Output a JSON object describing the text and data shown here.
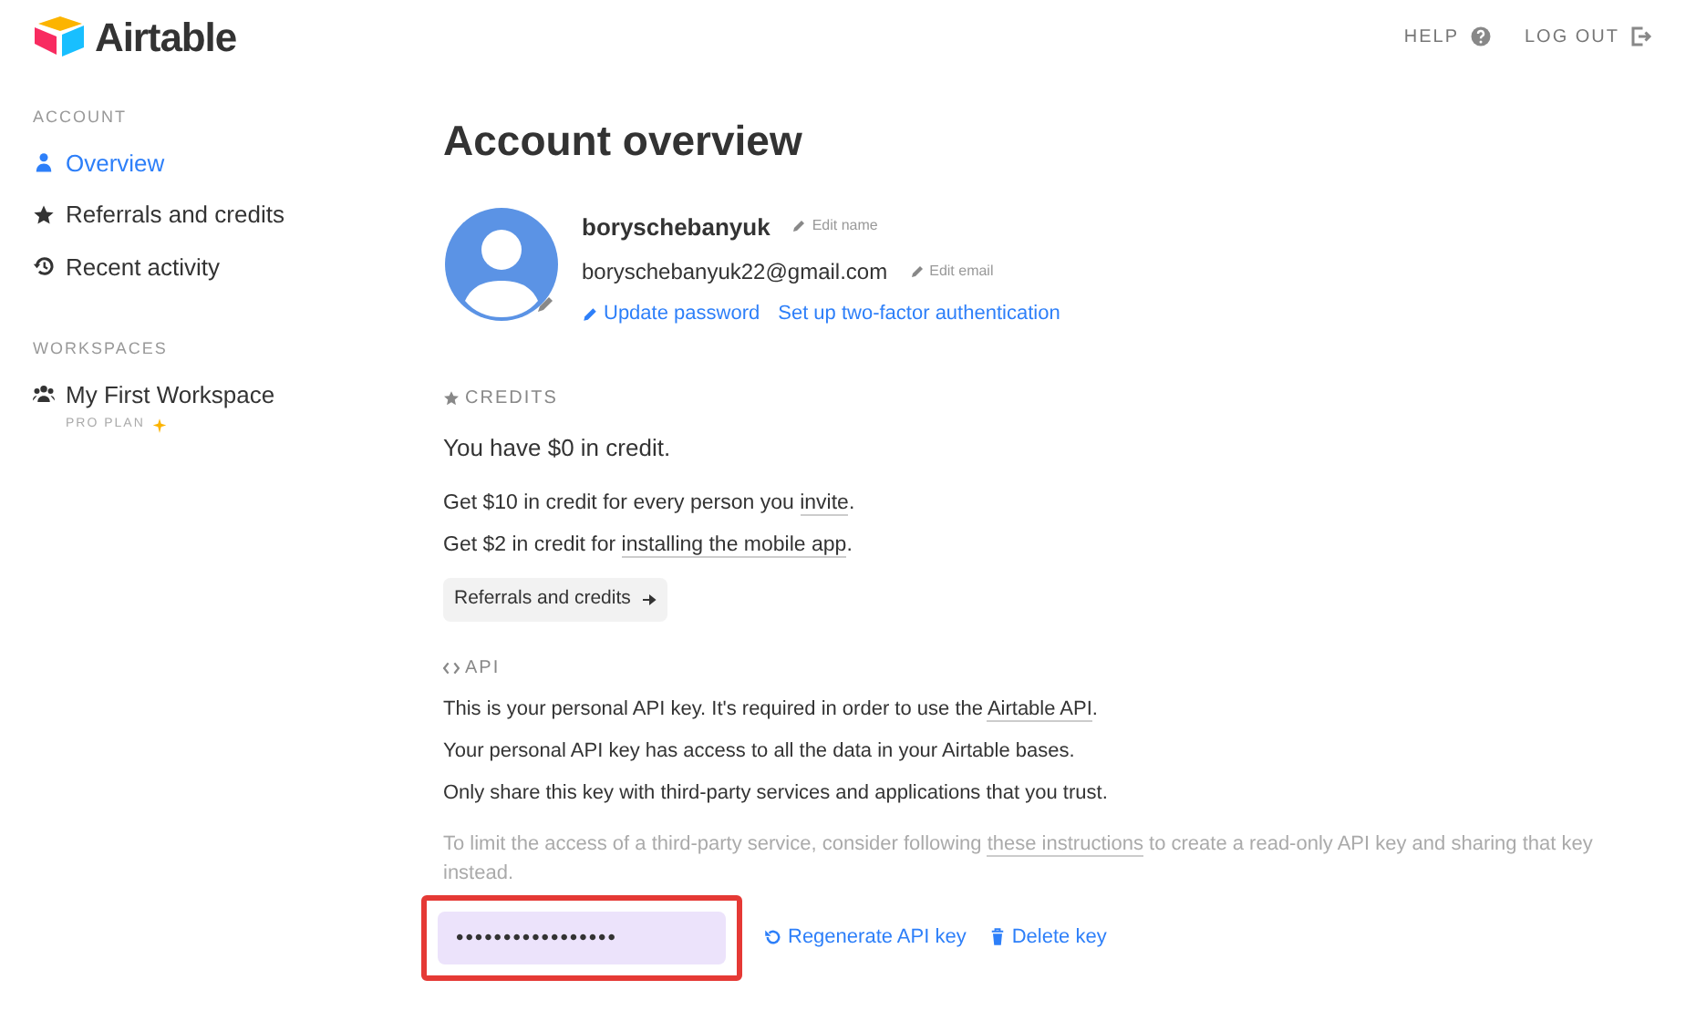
{
  "header": {
    "logo_text": "Airtable",
    "links": [
      {
        "kind": "help",
        "label": "HELP"
      },
      {
        "kind": "logout",
        "label": "LOG OUT"
      }
    ]
  },
  "sidebar": {
    "sections": [
      {
        "title": "ACCOUNT",
        "items": [
          {
            "kind": "person",
            "label": "Overview",
            "selected": true
          },
          {
            "kind": "star",
            "label": "Referrals and credits",
            "selected": false
          },
          {
            "kind": "history",
            "label": "Recent activity",
            "selected": false
          }
        ]
      },
      {
        "title": "WORKSPACES",
        "items": [
          {
            "kind": "group",
            "label": "My First Workspace",
            "sublabel": "PRO PLAN",
            "selected": false
          }
        ]
      }
    ]
  },
  "page_title": "Account overview",
  "profile": {
    "name": "boryschebanyuk",
    "edit_name": "Edit name",
    "email": "boryschebanyuk22@gmail.com",
    "edit_email": "Edit email",
    "update_password": "Update password",
    "two_factor": "Set up two-factor authentication"
  },
  "credits": {
    "heading": "CREDITS",
    "balance": "You have $0 in credit.",
    "lines": [
      {
        "before": "Get $10 in credit for every person you ",
        "link": "invite",
        "after": "."
      },
      {
        "before": "Get $2 in credit for ",
        "link": "installing the mobile app",
        "after": "."
      }
    ],
    "button": "Referrals and credits"
  },
  "api": {
    "heading": "API",
    "lines": [
      {
        "before": "This is your personal API key. It's required in order to use the ",
        "link": "Airtable API",
        "after": "."
      },
      {
        "before": "Your personal API key has access to all the data in your Airtable bases."
      },
      {
        "before": "Only share this key with third-party services and applications that you trust."
      }
    ],
    "note": {
      "before": "To limit the access of a third-party service, consider following ",
      "link": "these instructions",
      "after": " to create a read-only API key and sharing that key instead."
    },
    "key_value": "•••••••••••••••••",
    "highlighted": true,
    "regenerate": "Regenerate API key",
    "delete": "Delete key"
  }
}
